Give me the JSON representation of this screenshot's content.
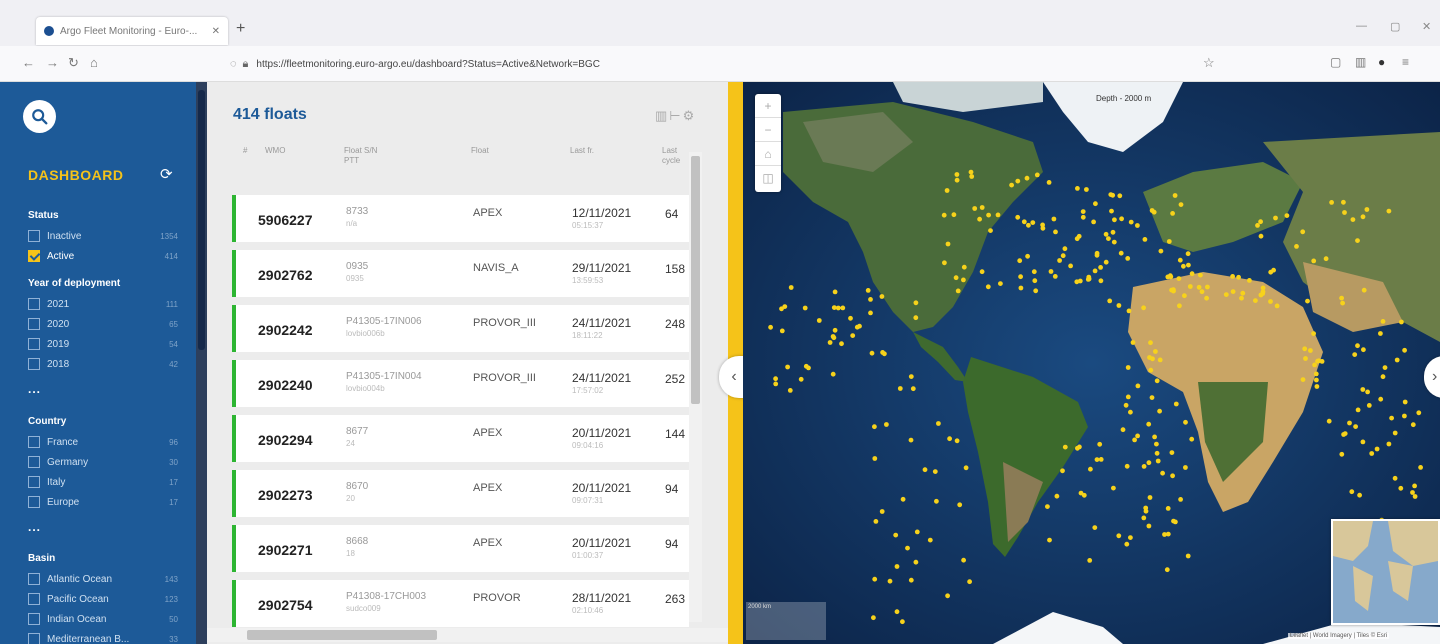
{
  "browser": {
    "tab_title": "Argo Fleet Monitoring - Euro-...",
    "tab_close": "✕",
    "new_tab": "+",
    "url": "https://fleetmonitoring.euro-argo.eu/dashboard?Status=Active&Network=BGC",
    "window_controls": [
      "—",
      "▢",
      "✕"
    ]
  },
  "sidebar": {
    "title": "DASHBOARD",
    "sections": {
      "status": {
        "label": "Status",
        "options": [
          {
            "label": "Inactive",
            "count": "1354",
            "checked": false
          },
          {
            "label": "Active",
            "count": "414",
            "checked": true
          }
        ]
      },
      "year": {
        "label": "Year of deployment",
        "options": [
          {
            "label": "2021",
            "count": "111"
          },
          {
            "label": "2020",
            "count": "65"
          },
          {
            "label": "2019",
            "count": "54"
          },
          {
            "label": "2018",
            "count": "42"
          }
        ]
      },
      "country": {
        "label": "Country",
        "options": [
          {
            "label": "France",
            "count": "96"
          },
          {
            "label": "Germany",
            "count": "30"
          },
          {
            "label": "Italy",
            "count": "17"
          },
          {
            "label": "Europe",
            "count": "17"
          }
        ]
      },
      "basin": {
        "label": "Basin",
        "options": [
          {
            "label": "Atlantic Ocean",
            "count": "143"
          },
          {
            "label": "Pacific Ocean",
            "count": "123"
          },
          {
            "label": "Indian Ocean",
            "count": "50"
          },
          {
            "label": "Mediterranean B...",
            "count": "33"
          }
        ]
      }
    },
    "more": "..."
  },
  "list": {
    "count_label": "414 floats",
    "headers": {
      "num": "#",
      "wmo": "WMO",
      "sn": "Float S/N",
      "sn2": "PTT",
      "model": "Float",
      "last": "Last fr.",
      "cycle": "Last",
      "cycle2": "cycle"
    },
    "rows": [
      {
        "wmo": "5906227",
        "sn": "8733",
        "pti": "n/a",
        "model": "APEX",
        "date": "12/11/2021",
        "time": "05:15:37",
        "cycle": "64"
      },
      {
        "wmo": "2902762",
        "sn": "0935",
        "pti": "0935",
        "model": "NAVIS_A",
        "date": "29/11/2021",
        "time": "13:59:53",
        "cycle": "158"
      },
      {
        "wmo": "2902242",
        "sn": "P41305-17IN006",
        "pti": "lovbio006b",
        "model": "PROVOR_III",
        "date": "24/11/2021",
        "time": "18:11:22",
        "cycle": "248"
      },
      {
        "wmo": "2902240",
        "sn": "P41305-17IN004",
        "pti": "lovbio004b",
        "model": "PROVOR_III",
        "date": "24/11/2021",
        "time": "17:57:02",
        "cycle": "252"
      },
      {
        "wmo": "2902294",
        "sn": "8677",
        "pti": "24",
        "model": "APEX",
        "date": "20/11/2021",
        "time": "09:04:16",
        "cycle": "144"
      },
      {
        "wmo": "2902273",
        "sn": "8670",
        "pti": "20",
        "model": "APEX",
        "date": "20/11/2021",
        "time": "09:07:31",
        "cycle": "94"
      },
      {
        "wmo": "2902271",
        "sn": "8668",
        "pti": "18",
        "model": "APEX",
        "date": "20/11/2021",
        "time": "01:00:37",
        "cycle": "94"
      },
      {
        "wmo": "2902754",
        "sn": "P41308-17CH003",
        "pti": "sudco009",
        "model": "PROVOR",
        "date": "28/11/2021",
        "time": "02:10:46",
        "cycle": "263"
      }
    ]
  },
  "map": {
    "depth_label": "Depth - 2000 m",
    "attribution": "Leaflet | World Imagery | Tiles © Esri",
    "scale_label": "2000 km",
    "float_color": "#f7d21b"
  }
}
